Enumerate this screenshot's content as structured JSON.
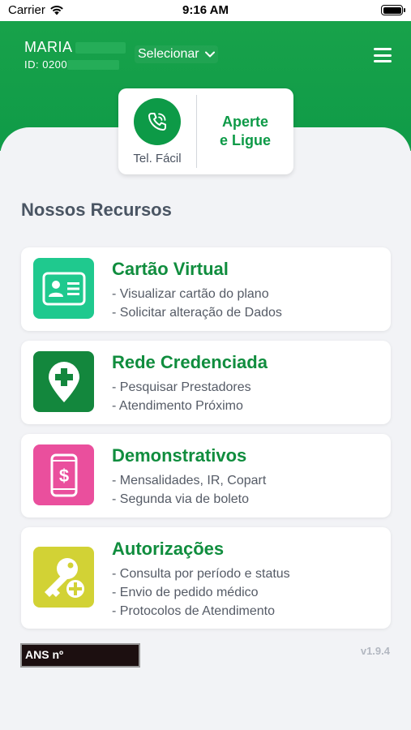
{
  "status_bar": {
    "carrier": "Carrier",
    "time": "9:16 AM"
  },
  "user": {
    "name": "MARIA",
    "id": "ID: 0200"
  },
  "selector": {
    "label": "Selecionar"
  },
  "call": {
    "label": "Tel. Fácil",
    "action_line1": "Aperte",
    "action_line2": "e Ligue"
  },
  "section_title": "Nossos Recursos",
  "cards": [
    {
      "title": "Cartão Virtual",
      "lines": [
        "- Visualizar cartão do plano",
        "- Solicitar alteração de Dados"
      ],
      "icon": "id-card-icon",
      "color": "#1fc98e"
    },
    {
      "title": "Rede Credenciada",
      "lines": [
        "- Pesquisar Prestadores",
        "- Atendimento Próximo"
      ],
      "icon": "location-plus-icon",
      "color": "#13873d"
    },
    {
      "title": "Demonstrativos",
      "lines": [
        "- Mensalidades, IR, Copart",
        "- Segunda via de boleto"
      ],
      "icon": "phone-dollar-icon",
      "color": "#ea4f9d"
    },
    {
      "title": "Autorizações",
      "lines": [
        "- Consulta por período e status",
        "- Envio de pedido médico",
        "- Protocolos de Atendimento"
      ],
      "icon": "key-plus-icon",
      "color": "#d2d235"
    }
  ],
  "footer": {
    "ans": "ANS nº",
    "version": "v1.9.4"
  },
  "colors": {
    "brand_green": "#0f9b48",
    "title_green": "#108d3e"
  }
}
